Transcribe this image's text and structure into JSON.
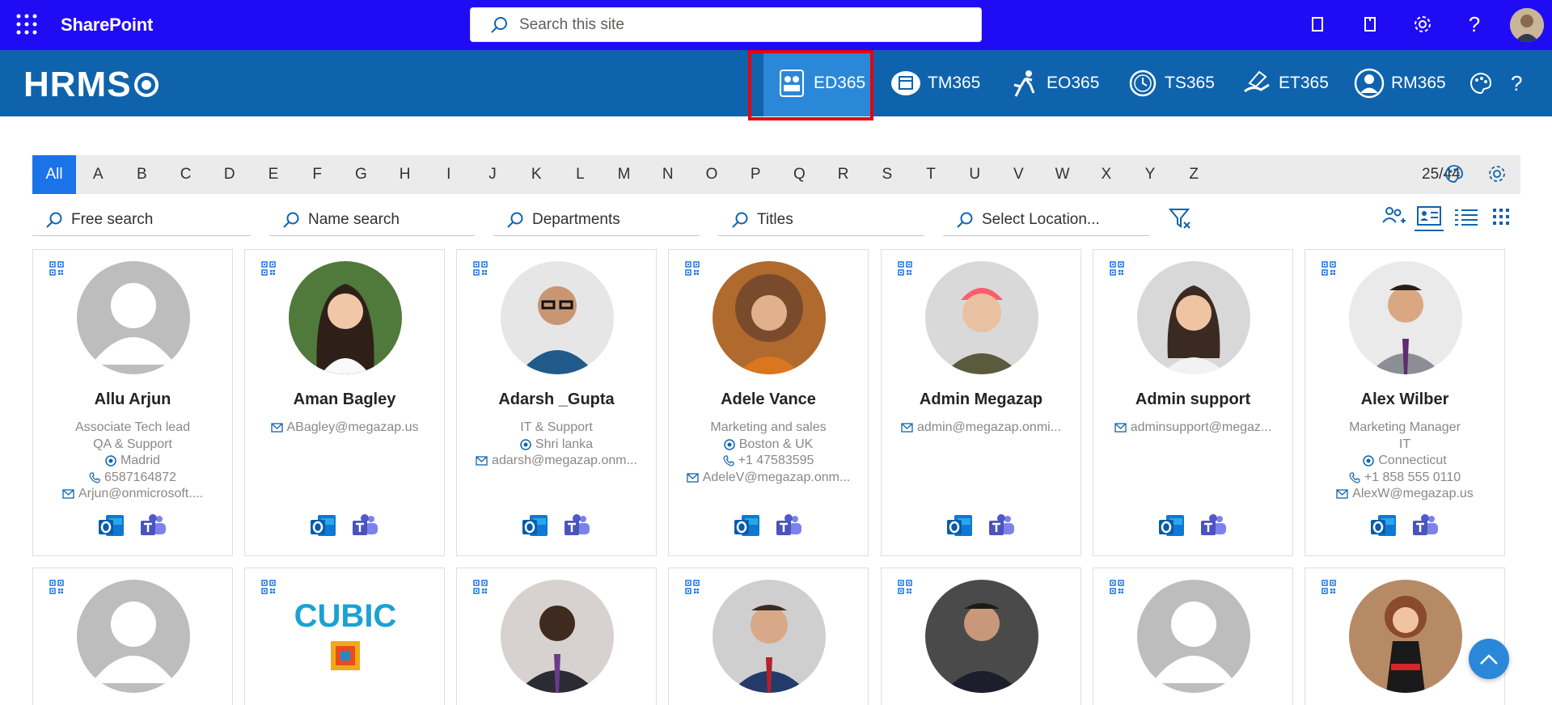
{
  "topbar": {
    "site_title": "SharePoint",
    "search_placeholder": "Search this site",
    "icons": [
      "app-launcher-icon",
      "notebook-icon",
      "document-icon",
      "settings-icon",
      "help-icon",
      "user-avatar"
    ]
  },
  "hrms": {
    "logo": "HRMS",
    "tabs": [
      {
        "label": "ED365",
        "icon": "employee-directory-icon",
        "active": true
      },
      {
        "label": "TM365",
        "icon": "calendar-icon",
        "active": false
      },
      {
        "label": "EO365",
        "icon": "runner-icon",
        "active": false
      },
      {
        "label": "TS365",
        "icon": "clock-icon",
        "active": false
      },
      {
        "label": "ET365",
        "icon": "expense-hand-icon",
        "active": false
      },
      {
        "label": "RM365",
        "icon": "person-icon",
        "active": false
      }
    ]
  },
  "alphabet": {
    "letters": [
      "All",
      "A",
      "B",
      "C",
      "D",
      "E",
      "F",
      "G",
      "H",
      "I",
      "J",
      "K",
      "L",
      "M",
      "N",
      "O",
      "P",
      "Q",
      "R",
      "S",
      "T",
      "U",
      "V",
      "W",
      "X",
      "Y",
      "Z"
    ],
    "active": "All",
    "count": "25/44"
  },
  "filters": {
    "free_search": "Free search",
    "name_search": "Name search",
    "departments": "Departments",
    "titles": "Titles",
    "location": "Select Location..."
  },
  "employees": [
    {
      "name": "Allu Arjun",
      "lines": [
        {
          "icon": "",
          "text": "Associate Tech lead"
        },
        {
          "icon": "",
          "text": "QA & Support"
        },
        {
          "icon": "location-icon",
          "text": "Madrid"
        },
        {
          "icon": "phone-icon",
          "text": "6587164872"
        },
        {
          "icon": "mail-icon",
          "text": "Arjun@onmicrosoft...."
        }
      ],
      "photo": "placeholder"
    },
    {
      "name": "Aman Bagley",
      "lines": [
        {
          "icon": "mail-icon",
          "text": "ABagley@megazap.us"
        }
      ],
      "photo": "woman-dark-hair"
    },
    {
      "name": "Adarsh _Gupta",
      "lines": [
        {
          "icon": "",
          "text": "IT & Support"
        },
        {
          "icon": "location-icon",
          "text": "Shri lanka"
        },
        {
          "icon": "mail-icon",
          "text": "adarsh@megazap.onm..."
        }
      ],
      "photo": "man-glasses"
    },
    {
      "name": "Adele Vance",
      "lines": [
        {
          "icon": "",
          "text": "Marketing and sales"
        },
        {
          "icon": "location-icon",
          "text": "Boston & UK"
        },
        {
          "icon": "phone-icon",
          "text": "+1 47583595"
        },
        {
          "icon": "mail-icon",
          "text": "AdeleV@megazap.onm..."
        }
      ],
      "photo": "woman-curly"
    },
    {
      "name": "Admin Megazap",
      "lines": [
        {
          "icon": "mail-icon",
          "text": "admin@megazap.onmi..."
        }
      ],
      "photo": "man-pink-hair"
    },
    {
      "name": "Admin support",
      "lines": [
        {
          "icon": "mail-icon",
          "text": "adminsupport@megaz..."
        }
      ],
      "photo": "woman-smile"
    },
    {
      "name": "Alex Wilber",
      "lines": [
        {
          "icon": "",
          "text": "Marketing Manager"
        },
        {
          "icon": "",
          "text": "IT"
        },
        {
          "icon": "location-icon",
          "text": "Connecticut"
        },
        {
          "icon": "phone-icon",
          "text": "+1 858 555 0110"
        },
        {
          "icon": "mail-icon",
          "text": "AlexW@megazap.us"
        }
      ],
      "photo": "man-tie"
    }
  ],
  "second_row_photos": [
    "placeholder",
    "cubic-logo",
    "man-suit",
    "man-suit-smile",
    "man-dark-suit",
    "placeholder",
    "woman-red-dress"
  ],
  "colors": {
    "sharepoint_bar": "#1f0cf5",
    "hrms_bar": "#0f63ad",
    "active_tab": "#2b88d8",
    "highlight": "#e8000b",
    "alpha_active": "#1a73e8"
  }
}
